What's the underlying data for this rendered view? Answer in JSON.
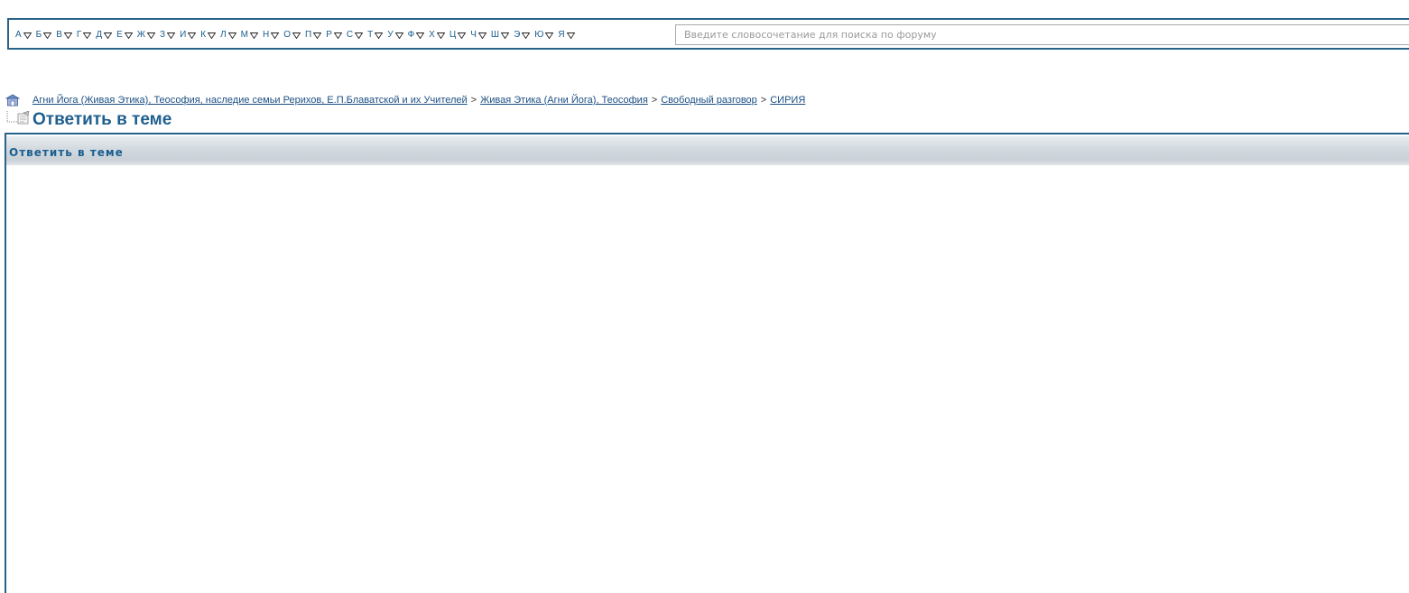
{
  "alphabet": [
    "А",
    "Б",
    "В",
    "Г",
    "Д",
    "Е",
    "Ж",
    "З",
    "И",
    "К",
    "Л",
    "М",
    "Н",
    "О",
    "П",
    "Р",
    "С",
    "Т",
    "У",
    "Ф",
    "Х",
    "Ц",
    "Ч",
    "Ш",
    "Э",
    "Ю",
    "Я"
  ],
  "search": {
    "placeholder": "Введите словосочетание для поиска по форуму",
    "value": ""
  },
  "breadcrumb": {
    "separator": ">",
    "items": [
      "Агни Йога (Живая Этика), Теософия, наследие семьи Рерихов, Е.П.Блаватской и их Учителей",
      "Живая Этика (Агни Йога), Теософия",
      "Свободный разговор",
      "СИРИЯ"
    ]
  },
  "page_title": "Ответить в теме",
  "panel": {
    "title": "Ответить в теме"
  },
  "colors": {
    "accent": "#1e5f8e",
    "border": "#2a6389",
    "link": "#1b4f84"
  }
}
